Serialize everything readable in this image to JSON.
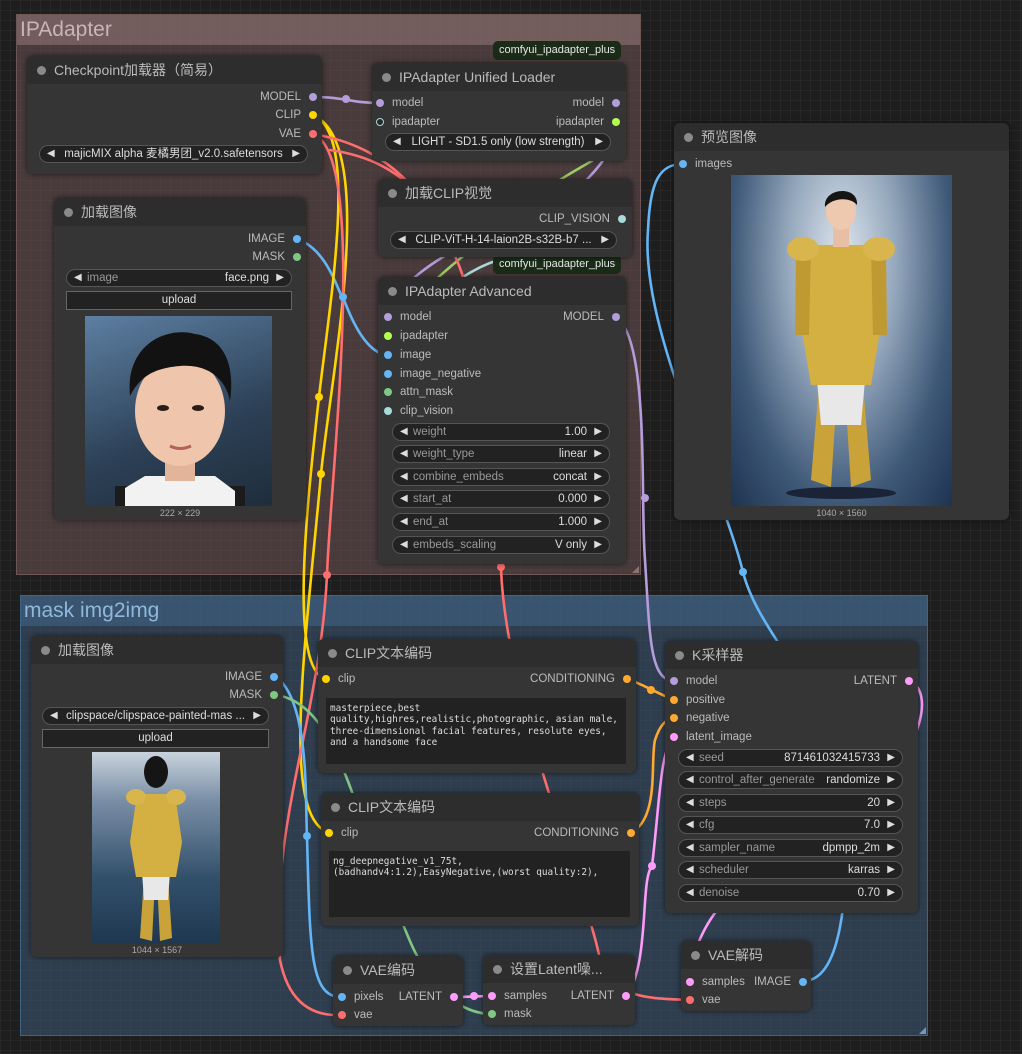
{
  "colors": {
    "model": "#b39ddb",
    "clip": "#ffd500",
    "vae": "#ff6e6e",
    "image": "#64b5f6",
    "mask": "#81c784",
    "latent": "#ff9cf9",
    "conditioning": "#ffa931",
    "ipadapter": "#b4ff4e",
    "clip_vision": "#a8dadc"
  },
  "groups": {
    "ipadapter": "IPAdapter",
    "mask_img2img": "mask img2img"
  },
  "badges": [
    "comfyui_ipadapter_plus",
    "comfyui_ipadapter_plus"
  ],
  "checkpoint": {
    "title": "Checkpoint加载器（简易）",
    "out_model": "MODEL",
    "out_clip": "CLIP",
    "out_vae": "VAE",
    "ckpt": "majicMIX alpha 麦橘男团_v2.0.safetensors"
  },
  "load_face": {
    "title": "加载图像",
    "out_image": "IMAGE",
    "out_mask": "MASK",
    "image_label": "image",
    "image_value": "face.png",
    "upload": "upload",
    "caption": "222 × 229"
  },
  "unified_loader": {
    "title": "IPAdapter Unified Loader",
    "in_model": "model",
    "in_ipadapter": "ipadapter",
    "out_model": "model",
    "out_ipadapter": "ipadapter",
    "preset": "LIGHT - SD1.5 only (low strength)"
  },
  "clip_vision_loader": {
    "title": "加载CLIP视觉",
    "out": "CLIP_VISION",
    "name": "CLIP-ViT-H-14-laion2B-s32B-b7 ..."
  },
  "ipa_advanced": {
    "title": "IPAdapter Advanced",
    "inputs": [
      "model",
      "ipadapter",
      "image",
      "image_negative",
      "attn_mask",
      "clip_vision"
    ],
    "out_model": "MODEL",
    "widgets": [
      {
        "label": "weight",
        "value": "1.00"
      },
      {
        "label": "weight_type",
        "value": "linear"
      },
      {
        "label": "combine_embeds",
        "value": "concat"
      },
      {
        "label": "start_at",
        "value": "0.000"
      },
      {
        "label": "end_at",
        "value": "1.000"
      },
      {
        "label": "embeds_scaling",
        "value": "V only"
      }
    ]
  },
  "preview": {
    "title": "预览图像",
    "in_images": "images",
    "caption": "1040 × 1560"
  },
  "load_mask": {
    "title": "加载图像",
    "out_image": "IMAGE",
    "out_mask": "MASK",
    "image_value": "clipspace/clipspace-painted-mas ...",
    "upload": "upload",
    "caption": "1044 × 1567"
  },
  "clip_pos": {
    "title": "CLIP文本编码",
    "in_clip": "clip",
    "out": "CONDITIONING",
    "text": "masterpiece,best quality,highres,realistic,photographic, asian male, three-dimensional facial features, resolute eyes, and a handsome face"
  },
  "clip_neg": {
    "title": "CLIP文本编码",
    "in_clip": "clip",
    "out": "CONDITIONING",
    "text": "ng_deepnegative_v1_75t,(badhandv4:1.2),EasyNegative,(worst quality:2),"
  },
  "ksampler": {
    "title": "K采样器",
    "inputs": [
      "model",
      "positive",
      "negative",
      "latent_image"
    ],
    "out": "LATENT",
    "widgets": [
      {
        "label": "seed",
        "value": "871461032415733"
      },
      {
        "label": "control_after_generate",
        "value": "randomize"
      },
      {
        "label": "steps",
        "value": "20"
      },
      {
        "label": "cfg",
        "value": "7.0"
      },
      {
        "label": "sampler_name",
        "value": "dpmpp_2m"
      },
      {
        "label": "scheduler",
        "value": "karras"
      },
      {
        "label": "denoise",
        "value": "0.70"
      }
    ]
  },
  "vae_encode": {
    "title": "VAE编码",
    "in_pixels": "pixels",
    "in_vae": "vae",
    "out": "LATENT"
  },
  "set_latent_mask": {
    "title": "设置Latent噪...",
    "in_samples": "samples",
    "in_mask": "mask",
    "out": "LATENT"
  },
  "vae_decode": {
    "title": "VAE解码",
    "in_samples": "samples",
    "in_vae": "vae",
    "out": "IMAGE"
  }
}
